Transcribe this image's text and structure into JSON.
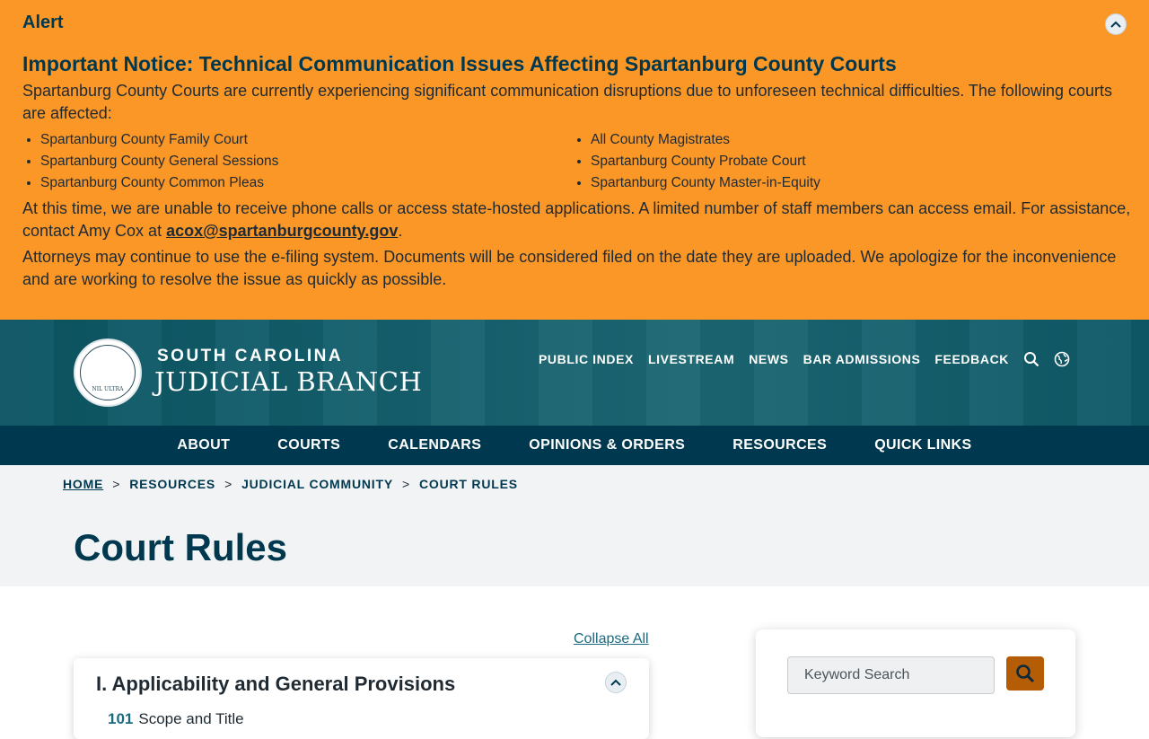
{
  "alert": {
    "heading": "Alert",
    "title": "Important Notice: Technical Communication Issues Affecting Spartanburg County Courts",
    "intro": "Spartanburg County Courts are currently experiencing significant communication disruptions due to unforeseen technical difficulties. The following courts are affected:",
    "courts_left": [
      "Spartanburg County Family Court",
      "Spartanburg County General Sessions",
      "Spartanburg County Common Pleas"
    ],
    "courts_right": [
      "All County Magistrates",
      "Spartanburg County Probate Court",
      "Spartanburg County Master-in-Equity"
    ],
    "p2_before": "At this time, we are unable to receive phone calls or access state-hosted applications. A limited number of staff members can access email. For assistance, contact Amy Cox at ",
    "p2_email": "acox@spartanburgcounty.gov",
    "p2_after": ".",
    "p3": "Attorneys may continue to use the e-filing system. Documents will be considered filed on the date they are uploaded. We apologize for the inconvenience and are working to resolve the issue as quickly as possible.",
    "background_color": "#fa9726"
  },
  "header": {
    "brand_top": "SOUTH CAROLINA",
    "brand_bottom": "JUDICIAL BRANCH",
    "seal_text": "NIL ULTRA",
    "utility_links": [
      "PUBLIC INDEX",
      "LIVESTREAM",
      "NEWS",
      "BAR ADMISSIONS",
      "FEEDBACK"
    ],
    "icons": [
      "search-icon",
      "globe-icon"
    ]
  },
  "main_nav": [
    "ABOUT",
    "COURTS",
    "CALENDARS",
    "OPINIONS & ORDERS",
    "RESOURCES",
    "QUICK LINKS"
  ],
  "breadcrumb": {
    "items": [
      "HOME",
      "RESOURCES",
      "JUDICIAL COMMUNITY",
      "COURT RULES"
    ],
    "separator": ">"
  },
  "page": {
    "title": "Court Rules",
    "collapse_all": "Collapse All"
  },
  "accordion": {
    "section_title": "I. Applicability and General Provisions",
    "first_rule_number": "101",
    "first_rule_label": "Scope and Title"
  },
  "search": {
    "placeholder": "Keyword Search",
    "value": "",
    "button_color": "#b55c07"
  },
  "colors": {
    "navy": "#00394f",
    "teal_header": "#15606d",
    "link": "#1a6a80"
  }
}
